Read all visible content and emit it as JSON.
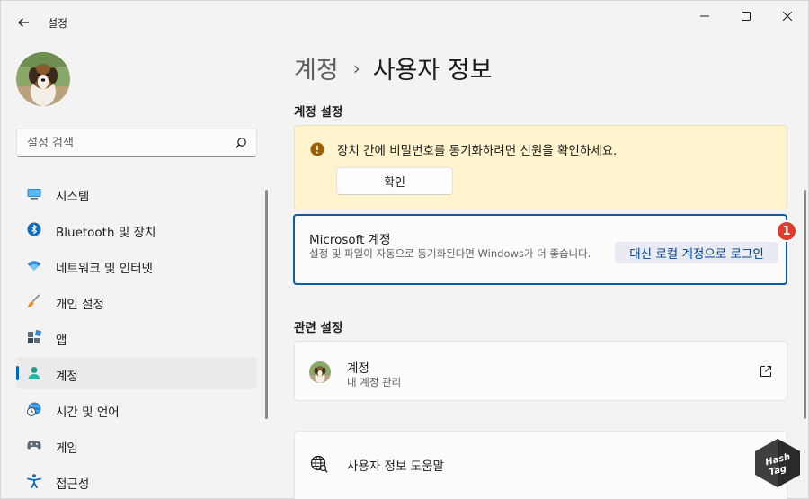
{
  "window": {
    "title": "설정"
  },
  "search": {
    "placeholder": "설정 검색"
  },
  "sidebar": {
    "items": [
      {
        "label": "시스템",
        "icon": "monitor-icon"
      },
      {
        "label": "Bluetooth 및 장치",
        "icon": "bluetooth-icon"
      },
      {
        "label": "네트워크 및 인터넷",
        "icon": "wifi-icon"
      },
      {
        "label": "개인 설정",
        "icon": "brush-icon"
      },
      {
        "label": "앱",
        "icon": "apps-icon"
      },
      {
        "label": "계정",
        "icon": "person-icon",
        "active": true
      },
      {
        "label": "시간 및 언어",
        "icon": "clock-globe-icon"
      },
      {
        "label": "게임",
        "icon": "gamepad-icon"
      },
      {
        "label": "접근성",
        "icon": "accessibility-icon"
      }
    ]
  },
  "breadcrumb": {
    "parent": "계정",
    "separator": "›",
    "current": "사용자 정보"
  },
  "account_settings": {
    "heading": "계정 설정",
    "warning_text": "장치 간에 비밀번호를 동기화하려면 신원을 확인하세요.",
    "confirm_label": "확인",
    "ms_title": "Microsoft 계정",
    "ms_desc": "설정 및 파일이 자동으로 동기화된다면 Windows가 더 좋습니다.",
    "local_login_label": "대신 로컬 계정으로 로그인",
    "step_badge": "1"
  },
  "related": {
    "heading": "관련 설정",
    "account_title": "계정",
    "account_sub": "내 계정 관리",
    "help_title": "사용자 정보 도움말"
  },
  "watermark": {
    "text_top": "Hash",
    "text_bottom": "Tag"
  },
  "colors": {
    "accent": "#0067c0",
    "warning_bg": "#fff4ce",
    "warning_icon": "#9d5d00",
    "focus_border": "#0f5ba8",
    "badge": "#e03c2b"
  }
}
